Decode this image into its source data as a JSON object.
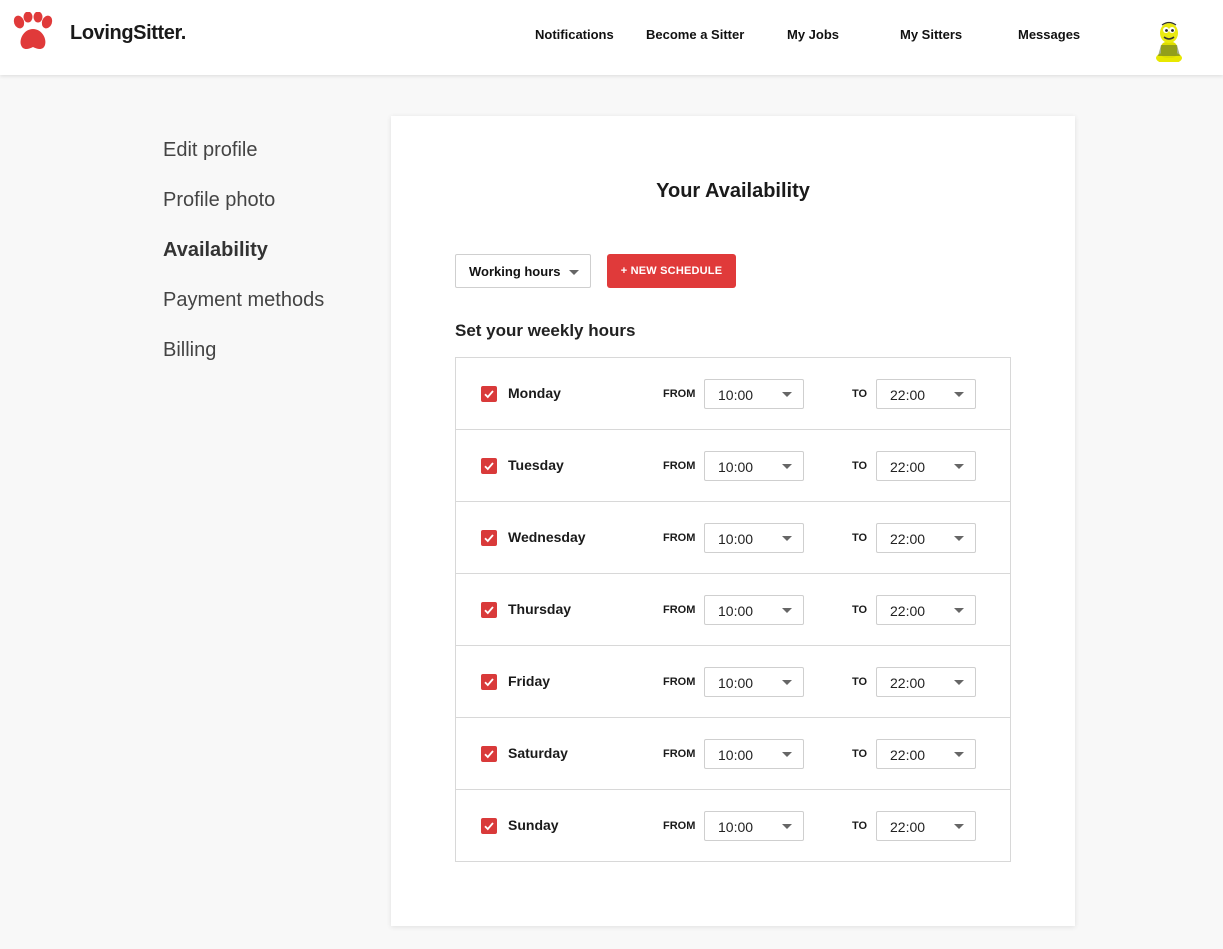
{
  "brand": {
    "name": "LovingSitter.",
    "accent_color": "#e03a3a"
  },
  "nav": {
    "items": [
      {
        "label": "Notifications"
      },
      {
        "label": "Become a Sitter"
      },
      {
        "label": "My Jobs"
      },
      {
        "label": "My Sitters"
      },
      {
        "label": "Messages"
      }
    ],
    "avatar_icon": "avatar-icon"
  },
  "sidebar": {
    "items": [
      {
        "label": "Edit profile",
        "active": false
      },
      {
        "label": "Profile photo",
        "active": false
      },
      {
        "label": "Availability",
        "active": true
      },
      {
        "label": "Payment methods",
        "active": false
      },
      {
        "label": "Billing",
        "active": false
      }
    ]
  },
  "availability": {
    "title": "Your Availability",
    "schedule_select": {
      "value": "Working hours"
    },
    "new_schedule_label": "+ NEW SCHEDULE",
    "section_label": "Set your weekly hours",
    "from_label": "FROM",
    "to_label": "TO",
    "days": [
      {
        "name": "Monday",
        "checked": true,
        "from": "10:00",
        "to": "22:00"
      },
      {
        "name": "Tuesday",
        "checked": true,
        "from": "10:00",
        "to": "22:00"
      },
      {
        "name": "Wednesday",
        "checked": true,
        "from": "10:00",
        "to": "22:00"
      },
      {
        "name": "Thursday",
        "checked": true,
        "from": "10:00",
        "to": "22:00"
      },
      {
        "name": "Friday",
        "checked": true,
        "from": "10:00",
        "to": "22:00"
      },
      {
        "name": "Saturday",
        "checked": true,
        "from": "10:00",
        "to": "22:00"
      },
      {
        "name": "Sunday",
        "checked": true,
        "from": "10:00",
        "to": "22:00"
      }
    ]
  }
}
